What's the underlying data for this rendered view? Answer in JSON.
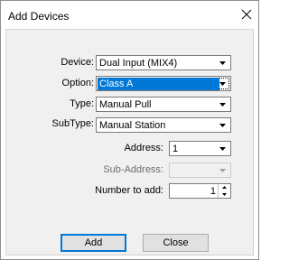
{
  "window": {
    "title": "Add Devices"
  },
  "form": {
    "device": {
      "label": "Device:",
      "value": "Dual Input (MIX4)"
    },
    "option": {
      "label": "Option:",
      "value": "Class A"
    },
    "type": {
      "label": "Type:",
      "value": "Manual Pull"
    },
    "subtype": {
      "label": "SubType:",
      "value": "Manual Station"
    },
    "address": {
      "label": "Address:",
      "value": "1"
    },
    "sub_address": {
      "label": "Sub-Address:",
      "value": ""
    },
    "number_to_add": {
      "label": "Number to add:",
      "value": "1"
    }
  },
  "buttons": {
    "add": "Add",
    "close": "Close"
  },
  "icons": {
    "close": "close-icon",
    "dropdown": "chevron-down-icon",
    "spin_up": "spin-up-icon",
    "spin_down": "spin-down-icon"
  }
}
